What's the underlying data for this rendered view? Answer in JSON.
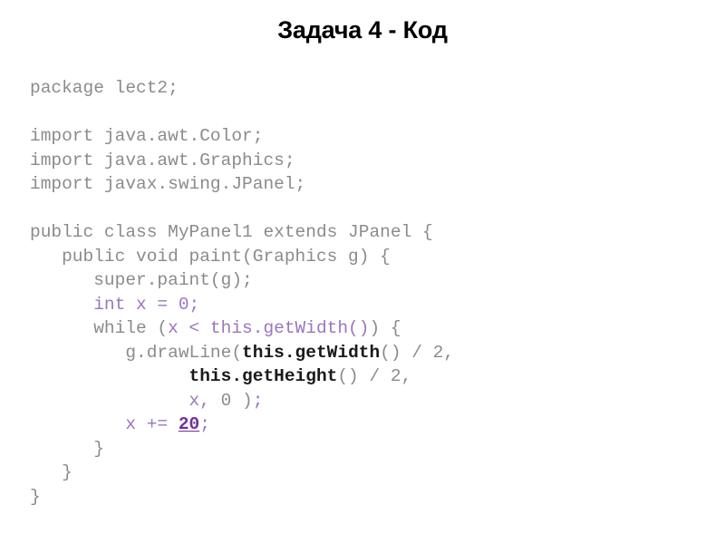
{
  "slide": {
    "title": "Задача 4 - Код",
    "background_color": "#ffffff"
  },
  "colors": {
    "code_plain": "#8b8b8b",
    "code_keyword": "#9a76c0",
    "code_bold": "#1a1a1a",
    "code_literal": "#7030a0",
    "title": "#000000"
  },
  "code": {
    "language": "java",
    "lines": [
      {
        "id": "l1",
        "segments": [
          {
            "text": "package lect2;",
            "style": "plain"
          }
        ]
      },
      {
        "id": "l2",
        "segments": [
          {
            "text": "",
            "style": "plain"
          }
        ]
      },
      {
        "id": "l3",
        "segments": [
          {
            "text": "import java.awt.Color;",
            "style": "plain"
          }
        ]
      },
      {
        "id": "l4",
        "segments": [
          {
            "text": "import java.awt.Graphics;",
            "style": "plain"
          }
        ]
      },
      {
        "id": "l5",
        "segments": [
          {
            "text": "import javax.swing.JPanel;",
            "style": "plain"
          }
        ]
      },
      {
        "id": "l6",
        "segments": [
          {
            "text": "",
            "style": "plain"
          }
        ]
      },
      {
        "id": "l7",
        "segments": [
          {
            "text": "public class MyPanel1 extends JPanel {",
            "style": "plain"
          }
        ]
      },
      {
        "id": "l8",
        "segments": [
          {
            "text": "   public void paint(Graphics g) {",
            "style": "plain"
          }
        ]
      },
      {
        "id": "l9",
        "segments": [
          {
            "text": "      super.paint(g);",
            "style": "plain"
          }
        ]
      },
      {
        "id": "l10",
        "segments": [
          {
            "text": "      ",
            "style": "plain"
          },
          {
            "text": "int x = 0;",
            "style": "keyword"
          }
        ]
      },
      {
        "id": "l11",
        "segments": [
          {
            "text": "      while (",
            "style": "plain"
          },
          {
            "text": "x < this.getWidth()",
            "style": "keyword"
          },
          {
            "text": ") {",
            "style": "plain"
          }
        ]
      },
      {
        "id": "l12",
        "segments": [
          {
            "text": "         g.drawLine(",
            "style": "plain"
          },
          {
            "text": "this.getWidth",
            "style": "bold"
          },
          {
            "text": "() / 2,",
            "style": "plain"
          }
        ]
      },
      {
        "id": "l13",
        "segments": [
          {
            "text": "               ",
            "style": "plain"
          },
          {
            "text": "this.getHeight",
            "style": "bold"
          },
          {
            "text": "() / 2,",
            "style": "plain"
          }
        ]
      },
      {
        "id": "l14",
        "segments": [
          {
            "text": "               ",
            "style": "plain"
          },
          {
            "text": "x,",
            "style": "keyword"
          },
          {
            "text": " 0 )",
            "style": "plain"
          },
          {
            "text": ";",
            "style": "keyword"
          }
        ]
      },
      {
        "id": "l15",
        "segments": [
          {
            "text": "         ",
            "style": "plain"
          },
          {
            "text": "x += ",
            "style": "keyword"
          },
          {
            "text": "20",
            "style": "literal"
          },
          {
            "text": ";",
            "style": "keyword"
          }
        ]
      },
      {
        "id": "l16",
        "segments": [
          {
            "text": "      }",
            "style": "plain"
          }
        ]
      },
      {
        "id": "l17",
        "segments": [
          {
            "text": "   }",
            "style": "plain"
          }
        ]
      },
      {
        "id": "l18",
        "segments": [
          {
            "text": "}",
            "style": "plain"
          }
        ]
      }
    ]
  }
}
